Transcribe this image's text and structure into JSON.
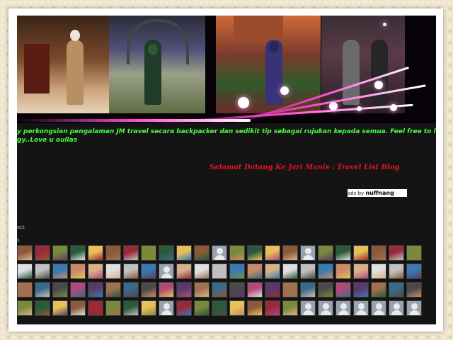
{
  "banner": {
    "title": "JM travel photo banner",
    "accent": "#ff48d2"
  },
  "ticker": {
    "line1": "y perkongsian pengalaman JM travel secara backpacker dan sedikit tip sebagai rujukan kepada semua. Feel free to l",
    "line2": "gy..Love u oullas",
    "color": "#47ff3c"
  },
  "welcome": {
    "text": "Selamat Datang Ke Jari Manis : Travel List Blog",
    "color": "#e5161f"
  },
  "ads": {
    "prefix": "ads by",
    "brand": "nuffnang"
  },
  "followers": {
    "label_cut1": "ect",
    "label_cut2": "s",
    "rows": 4,
    "per_row": 23
  }
}
